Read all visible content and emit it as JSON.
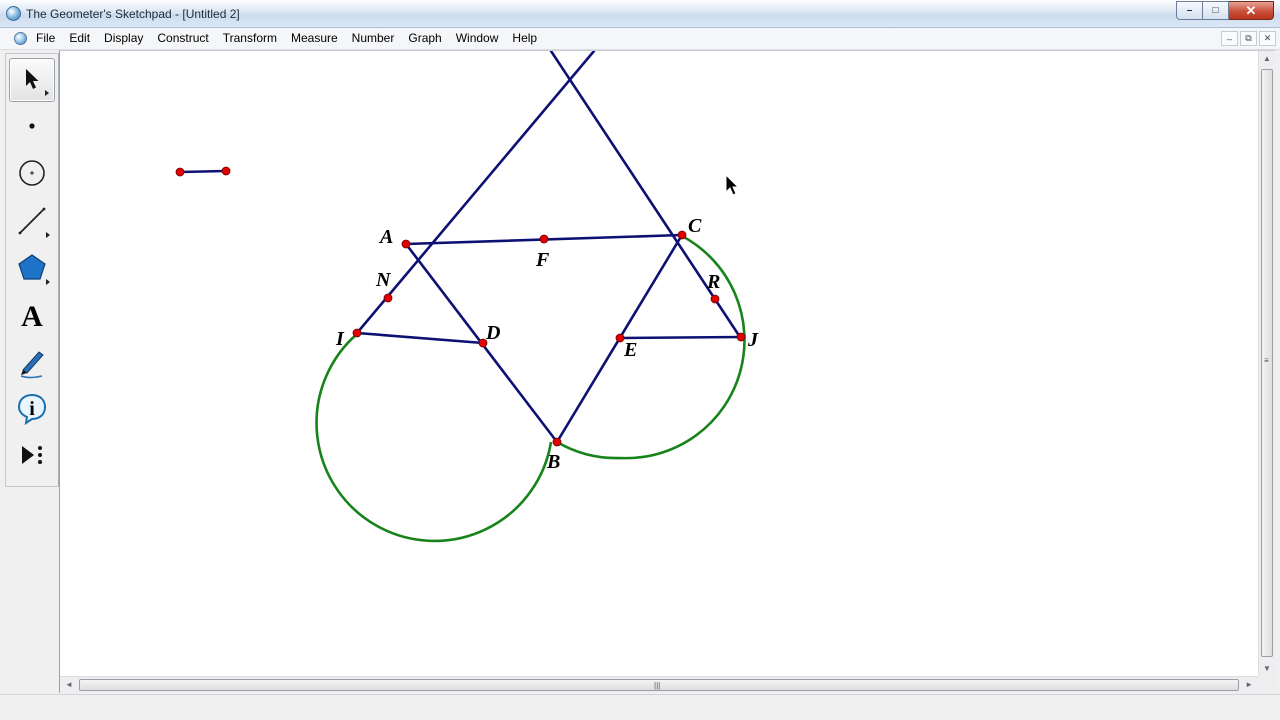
{
  "window": {
    "title": "The Geometer's Sketchpad - [Untitled 2]",
    "minimize": "–",
    "maximize": "□",
    "close": "✕"
  },
  "menu": {
    "items": [
      {
        "label": "File"
      },
      {
        "label": "Edit"
      },
      {
        "label": "Display"
      },
      {
        "label": "Construct"
      },
      {
        "label": "Transform"
      },
      {
        "label": "Measure"
      },
      {
        "label": "Number"
      },
      {
        "label": "Graph"
      },
      {
        "label": "Window"
      },
      {
        "label": "Help"
      }
    ],
    "doc_minimize": "–",
    "doc_restore": "⧉",
    "doc_close": "✕"
  },
  "toolbox": {
    "tools": [
      {
        "name": "arrow-tool",
        "icon": "arrow-icon",
        "selected": true
      },
      {
        "name": "point-tool",
        "icon": "point-icon"
      },
      {
        "name": "compass-tool",
        "icon": "compass-icon"
      },
      {
        "name": "straightedge-tool",
        "icon": "straightedge-icon"
      },
      {
        "name": "polygon-tool",
        "icon": "polygon-icon"
      },
      {
        "name": "text-tool",
        "icon": "text-icon",
        "label": "A"
      },
      {
        "name": "marker-tool",
        "icon": "marker-icon"
      },
      {
        "name": "information-tool",
        "icon": "information-icon",
        "label": "i"
      },
      {
        "name": "custom-tool",
        "icon": "custom-tool-icon"
      }
    ]
  },
  "sketch": {
    "colors": {
      "line": "#0c1173",
      "circle": "#17831a",
      "point": "#e00000",
      "point_outline": "#700000",
      "label": "#000000"
    },
    "points": {
      "A": "A",
      "B": "B",
      "C": "C",
      "D": "D",
      "E": "E",
      "F": "F",
      "I": "I",
      "J": "J",
      "N": "N",
      "R": "R"
    }
  },
  "scrollbars": {
    "up": "▲",
    "down": "▼",
    "left": "◄",
    "right": "►",
    "grip_v": "≡",
    "grip_h": "|||"
  }
}
